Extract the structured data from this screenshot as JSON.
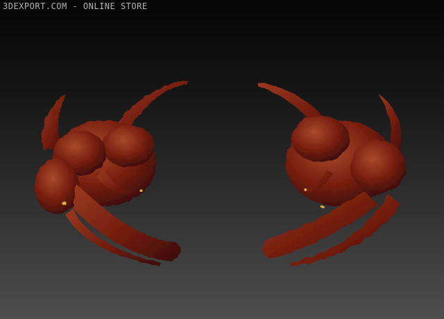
{
  "watermark": {
    "text": "3DEXPORT.COM - ONLINE STORE"
  },
  "colors": {
    "background_top": "#050505",
    "background_bottom": "#4e4e4e",
    "creature_base": "#7a1f10",
    "creature_dark": "#3a0c06",
    "creature_highlight": "#a84a2c",
    "claw_yellow": "#d9b13a"
  },
  "scene": {
    "description_icon": "creature-model",
    "views": [
      "front-view",
      "back-view"
    ]
  }
}
